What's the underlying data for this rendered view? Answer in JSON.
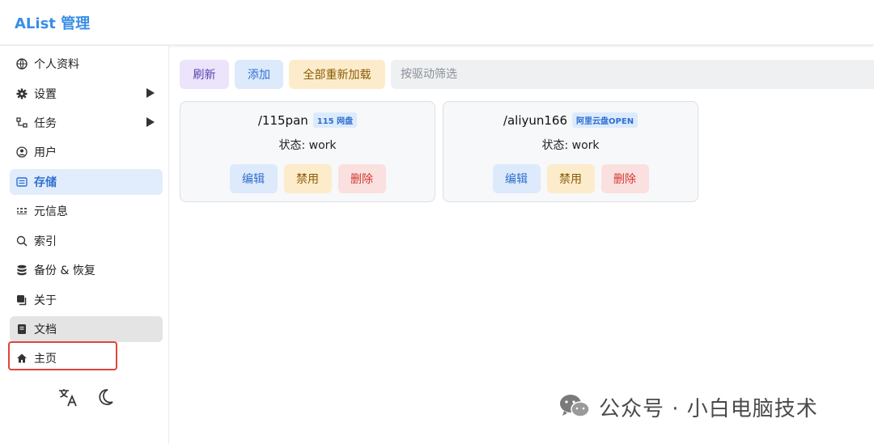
{
  "header": {
    "title": "AList 管理"
  },
  "sidebar": {
    "items": [
      {
        "label": "个人资料",
        "icon": "globe-icon"
      },
      {
        "label": "设置",
        "icon": "gear-icon",
        "expandable": true
      },
      {
        "label": "任务",
        "icon": "tasks-icon",
        "expandable": true
      },
      {
        "label": "用户",
        "icon": "user-icon"
      },
      {
        "label": "存储",
        "icon": "storage-icon",
        "active": true
      },
      {
        "label": "元信息",
        "icon": "meta-icon"
      },
      {
        "label": "索引",
        "icon": "search-icon"
      },
      {
        "label": "备份 & 恢复",
        "icon": "database-icon"
      },
      {
        "label": "关于",
        "icon": "copy-icon"
      },
      {
        "label": "文档",
        "icon": "book-icon"
      },
      {
        "label": "主页",
        "icon": "home-icon"
      }
    ],
    "footer_icons": [
      "translate-icon",
      "moon-icon"
    ]
  },
  "toolbar": {
    "refresh_label": "刷新",
    "add_label": "添加",
    "reload_all_label": "全部重新加载",
    "filter_placeholder": "按驱动筛选"
  },
  "storages": [
    {
      "mount_path": "/115pan",
      "driver": "115 网盘",
      "status": "状态: work",
      "edit_label": "编辑",
      "disable_label": "禁用",
      "delete_label": "删除"
    },
    {
      "mount_path": "/aliyun166",
      "driver": "阿里云盘OPEN",
      "status": "状态: work",
      "edit_label": "编辑",
      "disable_label": "禁用",
      "delete_label": "删除"
    }
  ],
  "watermark": {
    "text": "公众号 · 小白电脑技术",
    "icon": "wechat-icon"
  },
  "colors": {
    "accent": "#3a8ee6",
    "active_bg": "#e1edfd",
    "highlight_border": "#e0453a"
  }
}
